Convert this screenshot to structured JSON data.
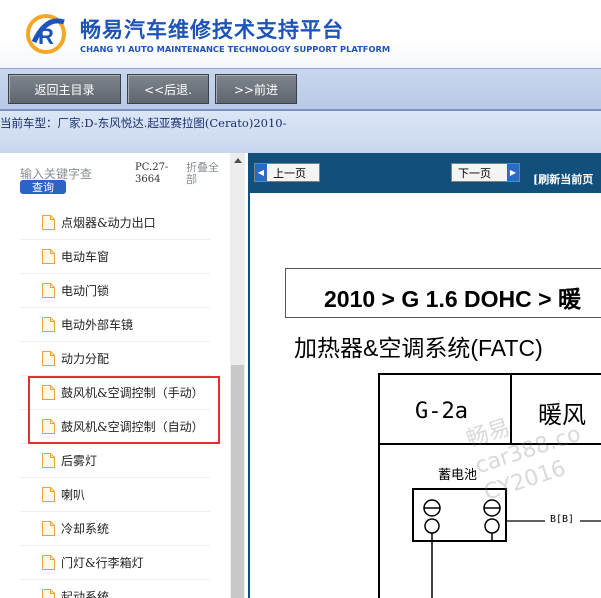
{
  "header": {
    "title": "畅易汽车维修技术支持平台",
    "subtitle": "CHANG YI AUTO MAINTENANCE TECHNOLOGY SUPPORT PLATFORM",
    "brand_color": "#1d54b8"
  },
  "toolbar": {
    "home_label": "返回主目录",
    "back_label": "<<后退.",
    "forward_label": ">>前进"
  },
  "vehicle": {
    "label": "当前车型：",
    "value": "厂家:D-东风悦达.起亚赛拉图(Cerato)2010-"
  },
  "sidebar": {
    "search_placeholder": "输入关键字查",
    "query_button": "查询",
    "pc_code": "PC.27-3664",
    "collapse_all": "折叠全部",
    "items": [
      {
        "label": "点烟器&动力出口"
      },
      {
        "label": "电动车窗"
      },
      {
        "label": "电动门锁"
      },
      {
        "label": "电动外部车镜"
      },
      {
        "label": "动力分配"
      },
      {
        "label": "鼓风机&空调控制（手动）"
      },
      {
        "label": "鼓风机&空调控制（自动）"
      },
      {
        "label": "后雾灯"
      },
      {
        "label": "喇叭"
      },
      {
        "label": "冷却系统"
      },
      {
        "label": "门灯&行李箱灯"
      },
      {
        "label": "起动系统"
      }
    ],
    "highlight_color": "#e03030"
  },
  "viewer": {
    "prev_label": "上一页",
    "next_label": "下一页",
    "refresh_label": "[刷新当前页",
    "nav_color": "#12507c"
  },
  "document": {
    "heading": "2010 > G 1.6 DOHC > 暖",
    "subtitle": "加热器&空调系统(FATC)",
    "diagram": {
      "code": "G-2a",
      "section_title": "暖风",
      "battery_label": "蓄电池",
      "wire_label": "B[B]"
    },
    "watermark": {
      "line1": "畅易",
      "line2": "car388.co",
      "line3": "CY2016"
    }
  }
}
